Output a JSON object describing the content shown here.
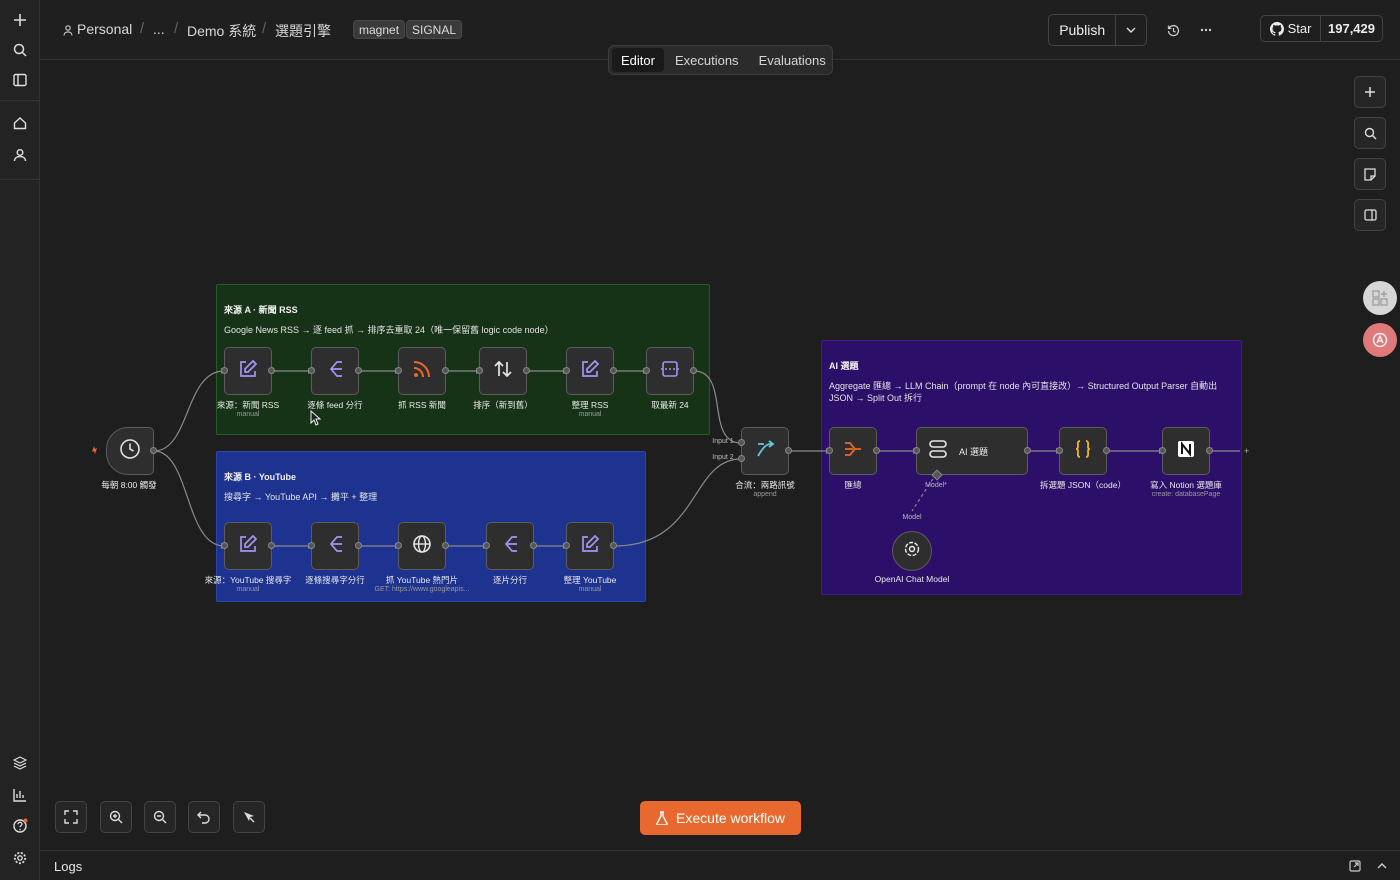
{
  "header": {
    "project": "Personal",
    "ellipsis": "...",
    "folder": "Demo 系統",
    "workflow": "選題引擎",
    "tags": [
      "magnet",
      "SIGNAL"
    ],
    "publish_label": "Publish",
    "github_star_label": "Star",
    "github_star_count": "197,429"
  },
  "tabs": [
    "Editor",
    "Executions",
    "Evaluations"
  ],
  "active_tab": "Editor",
  "stickies": {
    "a": {
      "title": "來源 A · 新聞 RSS",
      "desc": "Google News RSS → 逐 feed 抓 → 排序去重取 24（唯一保留舊 logic code node）",
      "color": "#173317"
    },
    "b": {
      "title": "來源 B · YouTube",
      "desc": "搜尋字 → YouTube API → 攤平 + 整理",
      "color": "#1e3290"
    },
    "c": {
      "title": "AI 選題",
      "desc": "Aggregate 匯總 → LLM Chain（prompt 在 node 內可直接改）→ Structured Output Parser 自動出 JSON → Split Out 拆行",
      "color": "#2c0f69"
    }
  },
  "nodes": {
    "trigger": {
      "label": "每朝 8:00 觸發",
      "icon": "clock-icon"
    },
    "a1": {
      "label": "來源：新聞 RSS",
      "sub": "manual",
      "icon": "edit-icon"
    },
    "a2": {
      "label": "逐條 feed 分行",
      "icon": "split-icon"
    },
    "a3": {
      "label": "抓 RSS 新聞",
      "icon": "rss-icon"
    },
    "a4": {
      "label": "排序（新到舊）",
      "icon": "sort-icon"
    },
    "a5": {
      "label": "整理 RSS",
      "sub": "manual",
      "icon": "edit-icon"
    },
    "a6": {
      "label": "取最新 24",
      "icon": "limit-icon"
    },
    "b1": {
      "label": "來源：YouTube 搜尋字",
      "sub": "manual",
      "icon": "edit-icon"
    },
    "b2": {
      "label": "逐條搜尋字分行",
      "icon": "split-icon"
    },
    "b3": {
      "label": "抓 YouTube 熱門片",
      "sub": "GET: https://www.googleapis...",
      "icon": "globe-icon"
    },
    "b4": {
      "label": "逐片分行",
      "icon": "split-icon"
    },
    "b5": {
      "label": "整理 YouTube",
      "sub": "manual",
      "icon": "edit-icon"
    },
    "merge": {
      "label": "合流：兩路訊號",
      "sub": "append",
      "input1": "Input 1",
      "input2": "Input 2",
      "icon": "merge-icon"
    },
    "c1": {
      "label": "匯總",
      "icon": "aggregate-icon"
    },
    "c2": {
      "label": "AI 選題",
      "model_port": "Model*",
      "icon": "ai-chain-icon"
    },
    "c3": {
      "label": "拆選題 JSON（code）",
      "icon": "code-icon"
    },
    "c4": {
      "label": "寫入 Notion 選題庫",
      "sub": "create: databasePage",
      "icon": "notion-icon"
    },
    "model": {
      "label": "OpenAI Chat Model",
      "port_label": "Model",
      "icon": "openai-icon"
    }
  },
  "execute_label": "Execute workflow",
  "logs_label": "Logs",
  "colors": {
    "accent": "#e8692f",
    "node_icon": "#a394f6",
    "rss": "#e8692f",
    "merge": "#5ec8d8",
    "aggregate": "#e8692f",
    "code": "#f0b429"
  }
}
